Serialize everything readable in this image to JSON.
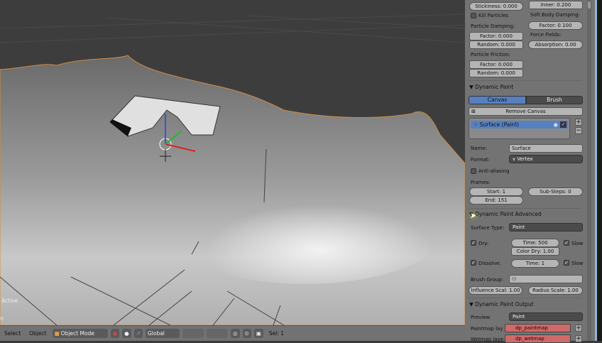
{
  "viewport": {
    "status_active": "Active",
    "status_n": "n"
  },
  "header": {
    "menus": [
      "Select",
      "Object"
    ],
    "mode": "Object Mode",
    "orientation": "Global",
    "selection": "Sel: 1"
  },
  "collision": {
    "stickiness": "Stickiness: 0.000",
    "inner": "Inner: 0.200",
    "kill_particles": "Kill Particles",
    "soft_body_damping": "Soft Body Damping:",
    "sb_factor": "Factor: 0.100",
    "particle_damping": "Particle Damping:",
    "pd_factor": "Factor: 0.000",
    "pd_random": "Random: 0.000",
    "force_fields": "Force Fields:",
    "absorption": "Absorption: 0.00",
    "particle_friction": "Particle Friction:",
    "pf_factor": "Factor: 0.000",
    "pf_random": "Random: 0.000"
  },
  "dynamic_paint": {
    "title": "Dynamic Paint",
    "tab_canvas": "Canvas",
    "tab_brush": "Brush",
    "remove_canvas": "Remove Canvas",
    "surface_item": "Surface (Paint)",
    "name_label": "Name:",
    "name_value": "Surface",
    "format_label": "Format:",
    "format_value": "Vertex",
    "anti_aliasing": "Anti-aliasing",
    "frames_label": "Frames:",
    "start": "Start: 1",
    "end": "End: 151",
    "substeps": "Sub-Steps: 0"
  },
  "advanced": {
    "title": "Dynamic Paint Advanced",
    "surface_type_label": "Surface Type:",
    "surface_type": "Paint",
    "dry": "Dry:",
    "dry_time": "Time: 500",
    "color_dry": "Color Dry: 1.00",
    "slow1": "Slow",
    "dissolve": "Dissolve:",
    "dissolve_time": "Time: 1",
    "slow2": "Slow",
    "brush_group": "Brush Group:",
    "influence_scale": "Influence Scal: 1.00",
    "radius_scale": "Radius Scale: 1.00"
  },
  "output": {
    "title": "Dynamic Paint Output",
    "preview_label": "Preview",
    "preview_value": "Paint",
    "paintmap_label": "Paintmap lay",
    "paintmap_value": "dp_paintmap",
    "wetmap_label": "Wetmap laye",
    "wetmap_value": "dp_wetmap"
  },
  "colors": {
    "accent": "#5680c2",
    "panel": "#737373",
    "missing_layer": "#d06a6a",
    "terrain_edge": "#d08a40"
  }
}
